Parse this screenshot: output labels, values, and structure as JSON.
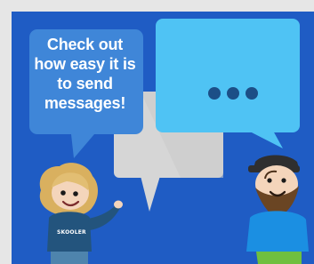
{
  "message": {
    "text": "Check out how easy it is to send messages!"
  },
  "shirt": {
    "logo": "SKOOLER"
  },
  "colors": {
    "panel_background": "#1f5cc4",
    "speech_bubble_blue": "#3f86d8",
    "chat_bubble_cyan": "#4fc3f4",
    "chat_bubble_gray": "#d6d6d6",
    "typing_dots": "#1c4f87"
  },
  "icons": {
    "typing_indicator": "three-dots-icon"
  }
}
